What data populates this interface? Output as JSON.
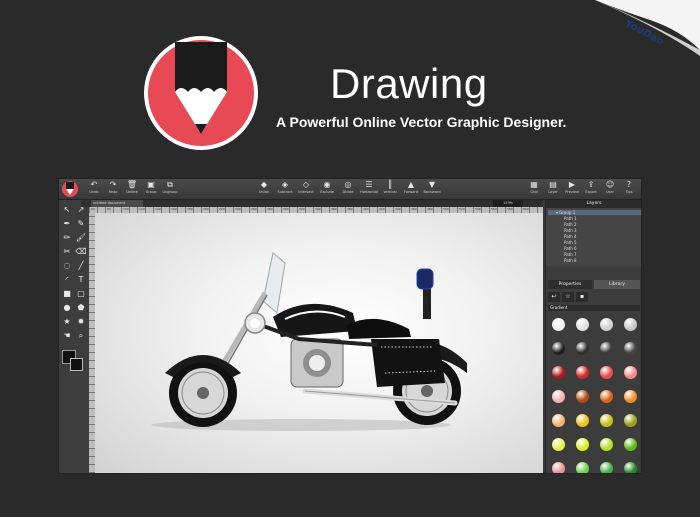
{
  "header": {
    "title": "Drawing",
    "tagline": "A Powerful Online Vector Graphic Designer.",
    "corner_badge": "YouDao"
  },
  "toolbar": {
    "left": [
      {
        "label": "Undo",
        "icon": "undo-icon",
        "glyph": "↶"
      },
      {
        "label": "Redo",
        "icon": "redo-icon",
        "glyph": "↷"
      },
      {
        "label": "Delete",
        "icon": "trash-icon",
        "glyph": "🗑"
      },
      {
        "label": "Group",
        "icon": "group-icon",
        "glyph": "▣"
      },
      {
        "label": "Ungroup",
        "icon": "ungroup-icon",
        "glyph": "⧉"
      }
    ],
    "middle": [
      {
        "label": "Union",
        "icon": "union-icon",
        "glyph": "◆"
      },
      {
        "label": "Subtract",
        "icon": "subtract-icon",
        "glyph": "◈"
      },
      {
        "label": "Intersect",
        "icon": "intersect-icon",
        "glyph": "◇"
      },
      {
        "label": "Exclude",
        "icon": "exclude-icon",
        "glyph": "◉"
      },
      {
        "label": "Divide",
        "icon": "divide-icon",
        "glyph": "◎"
      },
      {
        "label": "Horizontal",
        "icon": "align-horizontal-icon",
        "glyph": "☰"
      },
      {
        "label": "Vertical",
        "icon": "align-vertical-icon",
        "glyph": "║"
      },
      {
        "label": "Forward",
        "icon": "forward-icon",
        "glyph": "▲"
      },
      {
        "label": "Backward",
        "icon": "backward-icon",
        "glyph": "▼"
      }
    ],
    "right": [
      {
        "label": "Grid",
        "icon": "grid-icon",
        "glyph": "▦"
      },
      {
        "label": "Layer",
        "icon": "layer-icon",
        "glyph": "▤"
      },
      {
        "label": "Preview",
        "icon": "preview-icon",
        "glyph": "▶"
      },
      {
        "label": "Export",
        "icon": "export-icon",
        "glyph": "⇪"
      },
      {
        "label": "User",
        "icon": "user-icon",
        "glyph": "☺"
      },
      {
        "label": "Tips",
        "icon": "help-icon",
        "glyph": "?"
      }
    ]
  },
  "document": {
    "tab_label": "untitled document",
    "zoom": "123%"
  },
  "ruler_numbers": [
    "60",
    "80",
    "100",
    "120",
    "140",
    "160",
    "180",
    "200",
    "220",
    "240",
    "260",
    "280",
    "300",
    "320",
    "340",
    "360",
    "380",
    "400",
    "420",
    "440",
    "460",
    "480",
    "500",
    "520",
    "540",
    "560",
    "580",
    "600"
  ],
  "layers": {
    "title": "Layers",
    "items": [
      "Group 1",
      "Path 1",
      "Path 2",
      "Path 3",
      "Path 4",
      "Path 5",
      "Path 6",
      "Path 7",
      "Path 8"
    ]
  },
  "panel": {
    "properties_tab": "Properties",
    "library_tab": "Library",
    "gradient_label": "Gradient"
  },
  "gradient_swatches": [
    [
      "#f0f0f0",
      "#e0e0e0",
      "#d0d0d0",
      "#c8c8c8"
    ],
    [
      "#202020",
      "#2e2e2e",
      "#3a3a3a",
      "#444444"
    ],
    [
      "#b01818",
      "#d02828",
      "#f04848",
      "#f48a8a"
    ],
    [
      "#f4b0b0",
      "#b04a18",
      "#d86418",
      "#f08c28"
    ],
    [
      "#f8b070",
      "#e8c020",
      "#c8c018",
      "#98a018"
    ],
    [
      "#e8f048",
      "#d8f028",
      "#b0e028",
      "#60b818"
    ],
    [
      "#f09090",
      "#70d050",
      "#40b040",
      "#208820"
    ]
  ],
  "colors": {
    "brand_red": "#e84a55",
    "background": "#2a2a2a"
  }
}
